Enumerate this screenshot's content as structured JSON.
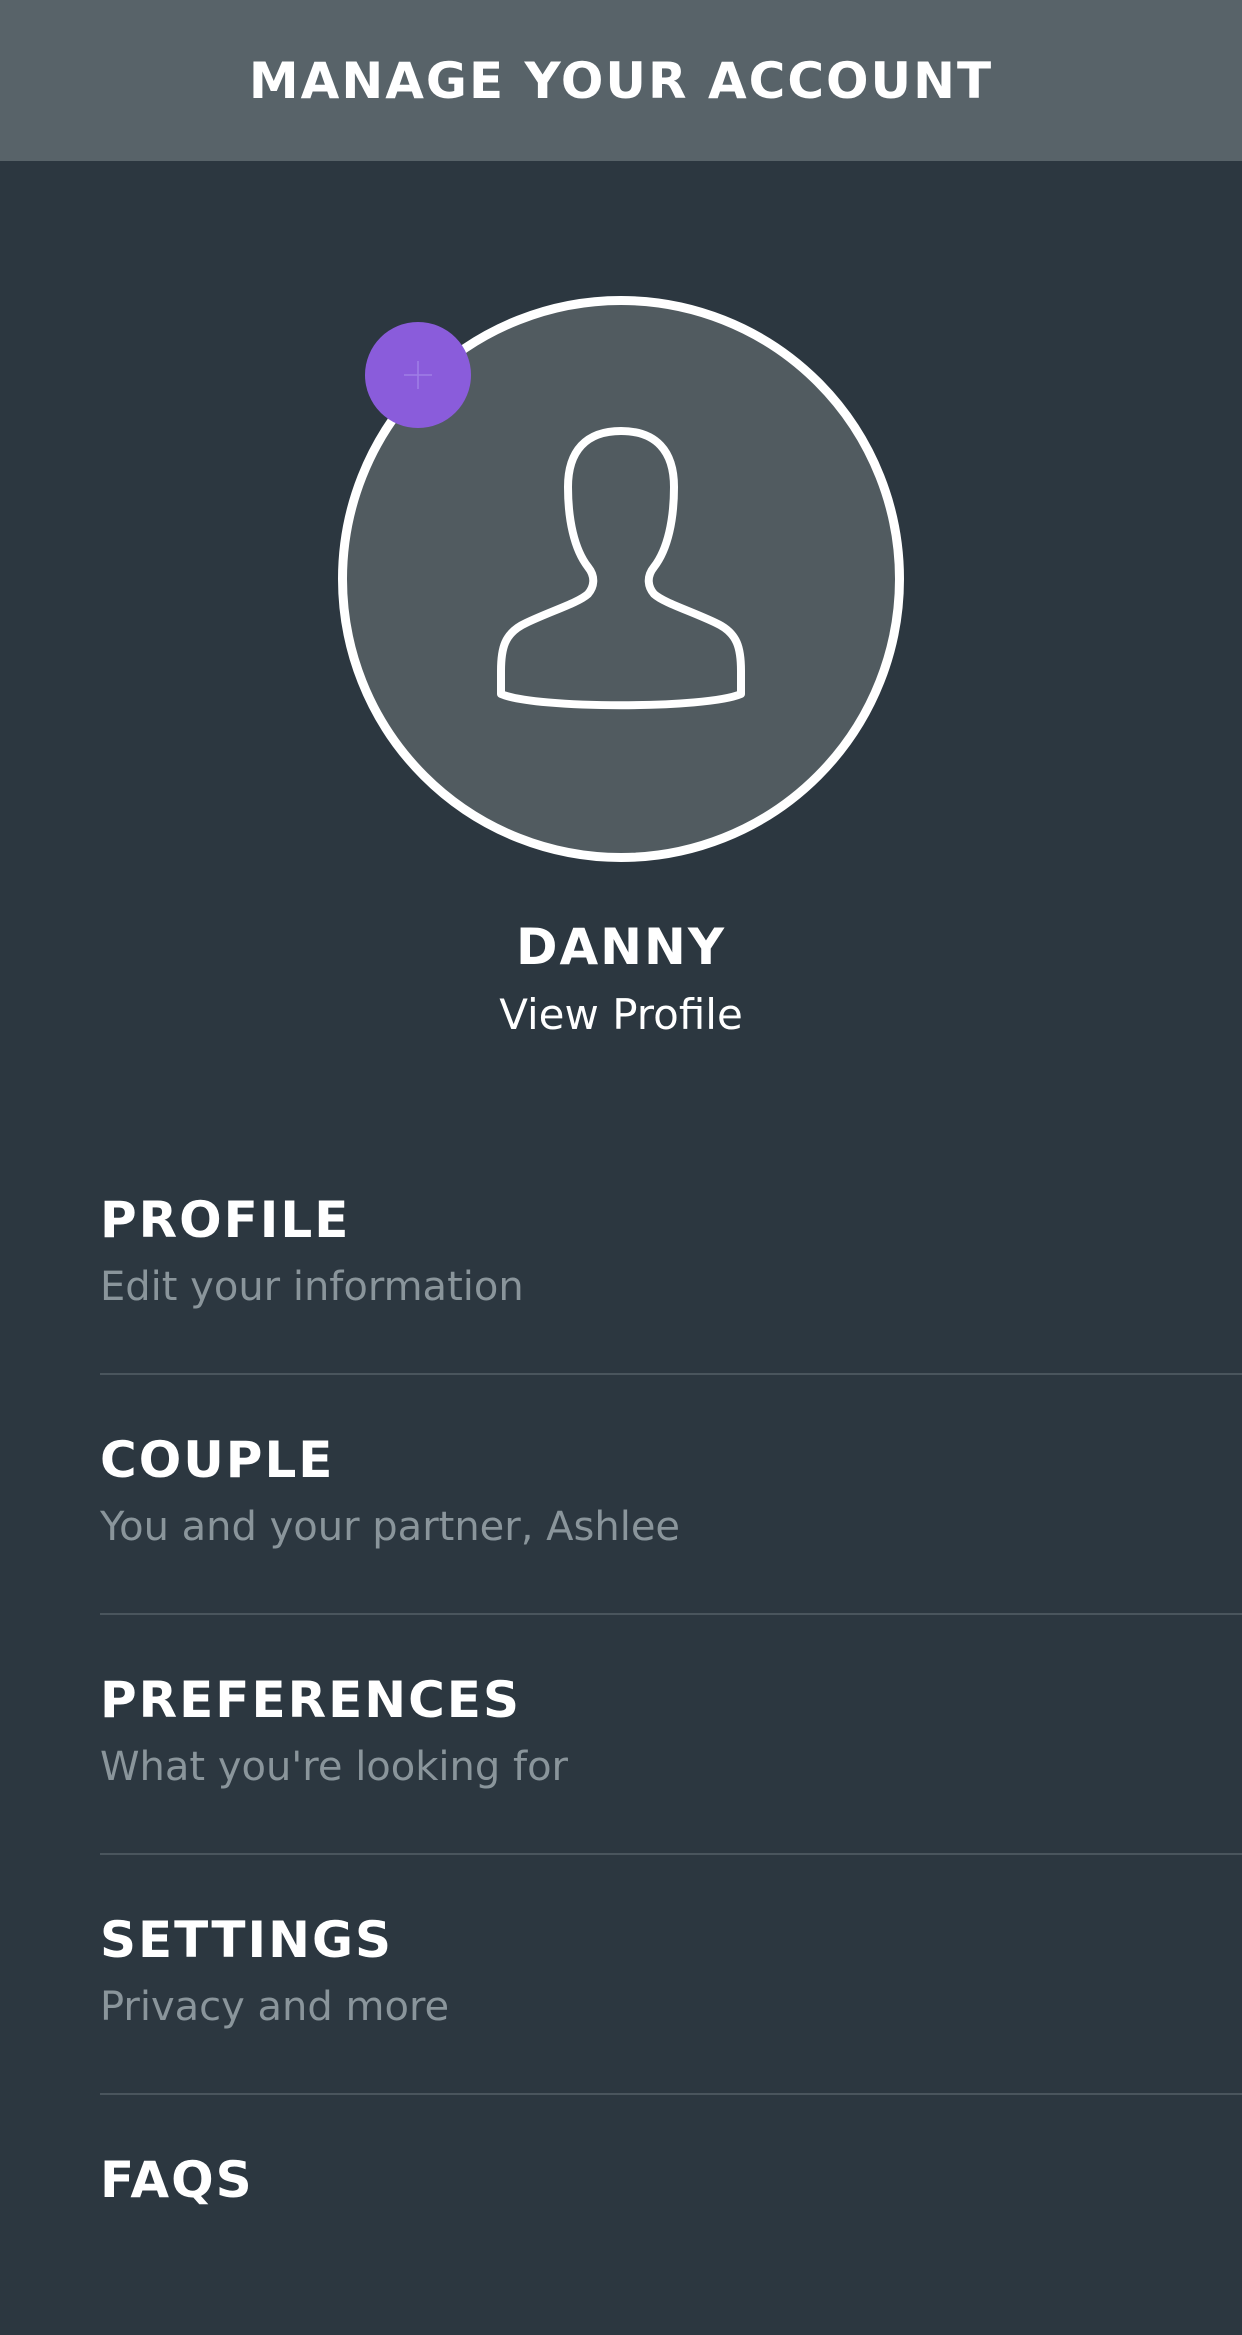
{
  "header": {
    "title": "MANAGE YOUR ACCOUNT"
  },
  "profile": {
    "name": "DANNY",
    "view_profile_label": "View Profile",
    "avatar_icon": "user-silhouette-icon",
    "add_photo_icon": "plus-icon",
    "accent_color": "#8a5cdb"
  },
  "menu": {
    "items": [
      {
        "title": "PROFILE",
        "subtitle": "Edit your information"
      },
      {
        "title": "COUPLE",
        "subtitle": "You and your partner, Ashlee"
      },
      {
        "title": "PREFERENCES",
        "subtitle": "What you're looking for"
      },
      {
        "title": "SETTINGS",
        "subtitle": "Privacy and more"
      },
      {
        "title": "FAQS",
        "subtitle": ""
      }
    ]
  },
  "colors": {
    "background": "#2c3740",
    "header_background": "#586369",
    "subtitle_text": "#8a959b"
  }
}
